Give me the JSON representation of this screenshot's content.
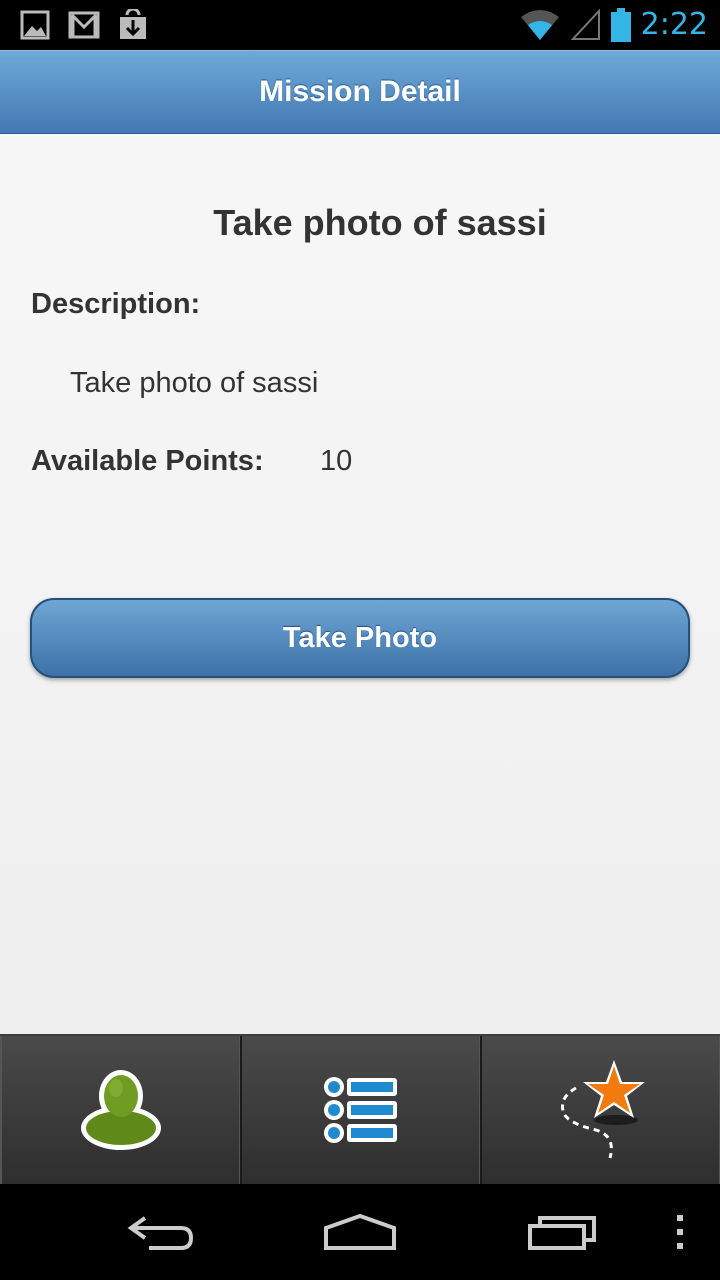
{
  "status_bar": {
    "time": "2:22",
    "icons_left": [
      "image-icon",
      "gmail-icon",
      "download-icon"
    ],
    "icons_right": [
      "wifi-icon",
      "signal-icon",
      "battery-icon"
    ],
    "accent_color": "#33b5e5"
  },
  "header": {
    "title": "Mission Detail"
  },
  "mission": {
    "title": "Take photo of sassi",
    "description_label": "Description:",
    "description": "Take photo of sassi",
    "points_label": "Available Points:",
    "points_value": "10"
  },
  "actions": {
    "take_photo_label": "Take Photo"
  },
  "tabs": [
    {
      "icon": "user-profile-icon"
    },
    {
      "icon": "mission-list-icon"
    },
    {
      "icon": "star-path-icon"
    }
  ],
  "nav": {
    "buttons": [
      "back-icon",
      "home-icon",
      "recent-apps-icon",
      "menu-icon"
    ]
  }
}
